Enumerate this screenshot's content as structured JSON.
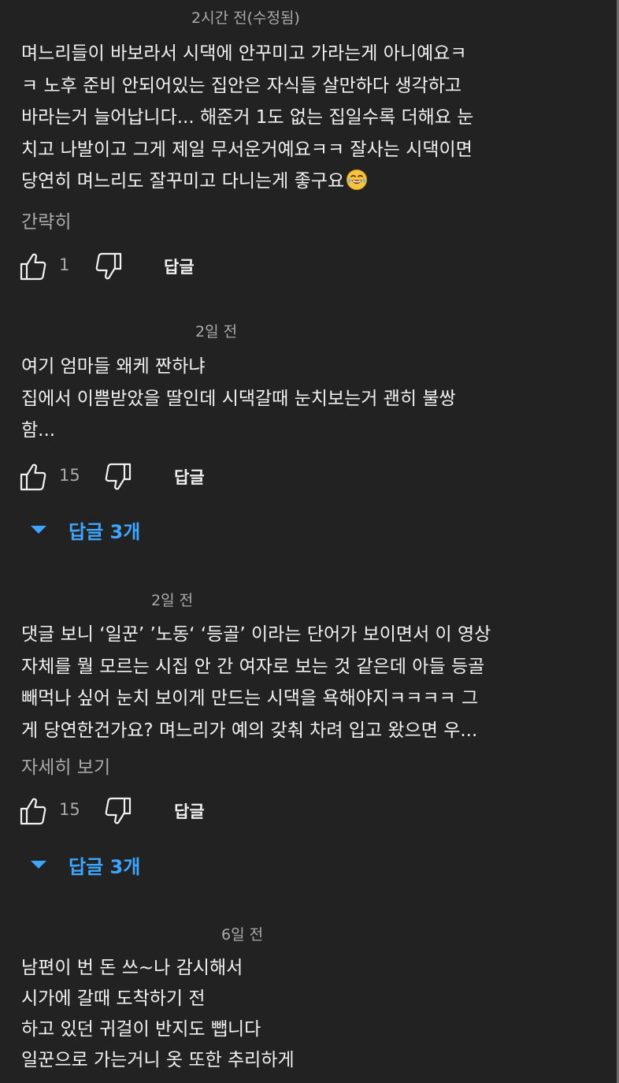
{
  "colors": {
    "background": "#222222",
    "text": "#f1f1f1",
    "muted": "#aaaaaa",
    "link": "#3ea6ff"
  },
  "comments": [
    {
      "time": "2시간 전(수정됨)",
      "lines": [
        "며느리들이 바보라서 시댁에 안꾸미고 가라는게 아니예요ㅋ",
        "ㅋ 노후 준비 안되어있는 집안은 자식들 살만하다 생각하고",
        "바라는거 늘어납니다... 해준거 1도 없는 집일수록 더해요 눈",
        "치고 나발이고 그게 제일 무서운거예요ㅋㅋ 잘사는 시댁이면",
        "당연히 며느리도 잘꾸미고 다니는게 좋구요"
      ],
      "trailing_emoji": "laughing-tears-emoji",
      "more_label": "간략히",
      "like_icon": "thumbs-up-icon",
      "dislike_icon": "thumbs-down-icon",
      "like_count": "1",
      "reply_label": "답글"
    },
    {
      "time": "2일 전",
      "lines": [
        "여기 엄마들 왜케 짠하냐",
        "집에서 이쁨받았을 딸인데 시댁갈때 눈치보는거 괜히 불쌍",
        "함..."
      ],
      "like_icon": "thumbs-up-icon",
      "dislike_icon": "thumbs-down-icon",
      "like_count": "15",
      "reply_label": "답글",
      "replies_label": "답글 3개",
      "replies_icon": "caret-down-icon"
    },
    {
      "time": "2일 전",
      "lines": [
        "댓글 보니 ‘일꾼’ ’노동‘ ‘등골’ 이라는 단어가 보이면서 이 영상",
        "자체를 뭘 모르는 시집 안 간 여자로 보는 것 같은데 아들 등골",
        "빼먹나 싶어 눈치 보이게 만드는 시댁을 욕해야지ㅋㅋㅋㅋ 그",
        "게 당연한건가요? 며느리가 예의 갖춰 차려 입고 왔으면 우..."
      ],
      "more_label": "자세히 보기",
      "like_icon": "thumbs-up-icon",
      "dislike_icon": "thumbs-down-icon",
      "like_count": "15",
      "reply_label": "답글",
      "replies_label": "답글 3개",
      "replies_icon": "caret-down-icon"
    },
    {
      "time": "6일 전",
      "lines": [
        "남편이 번 돈 쓰~나 감시해서",
        "시가에 갈때 도착하기 전",
        "하고 있던 귀걸이 반지도 뺍니다",
        "일꾼으로 가는거니 옷 또한 추리하게"
      ]
    }
  ]
}
